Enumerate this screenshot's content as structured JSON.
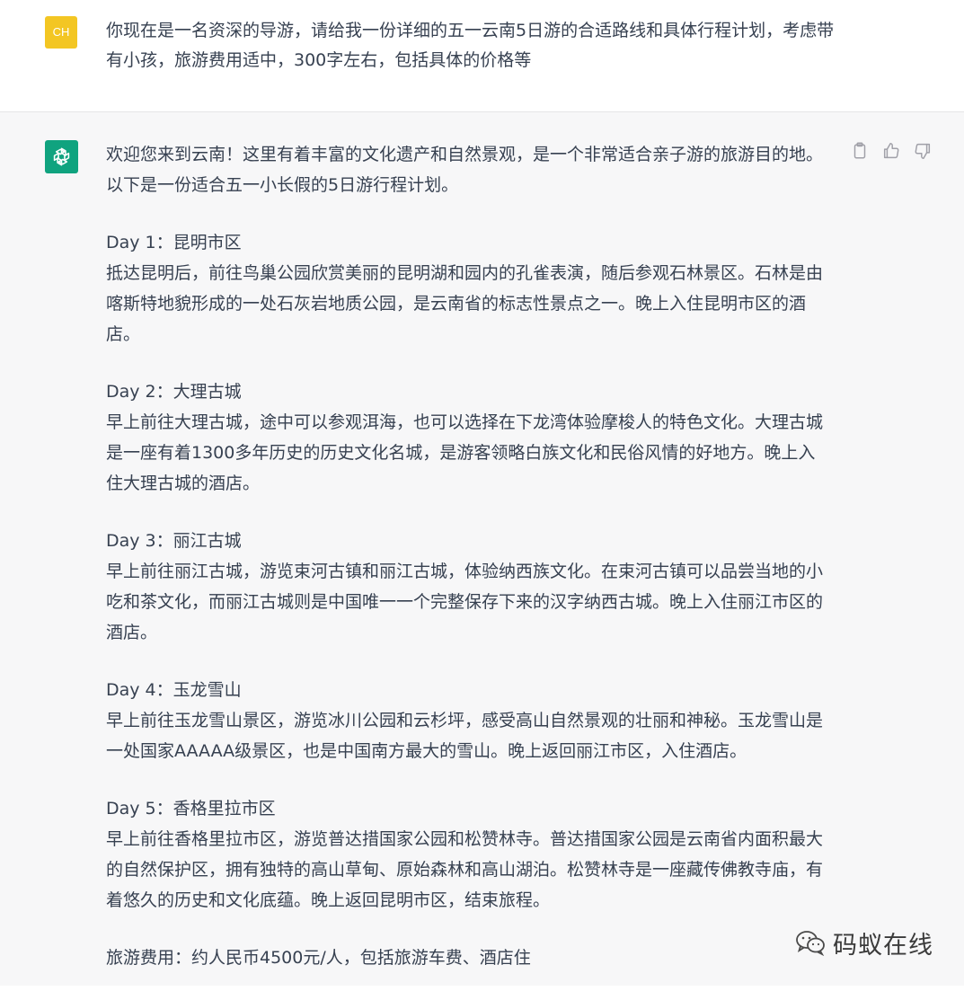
{
  "user": {
    "avatar_initials": "CH",
    "avatar_color": "#f3c623",
    "message": "你现在是一名资深的导游，请给我一份详细的五一云南5日游的合适路线和具体行程计划，考虑带有小孩，旅游费用适中，300字左右，包括具体的价格等"
  },
  "assistant": {
    "avatar_color": "#10a37f",
    "avatar_icon": "openai-logo-icon",
    "intro": "欢迎您来到云南！这里有着丰富的文化遗产和自然景观，是一个非常适合亲子游的旅游目的地。以下是一份适合五一小长假的5日游行程计划。",
    "days": [
      {
        "title": "Day 1：昆明市区",
        "body": "抵达昆明后，前往鸟巢公园欣赏美丽的昆明湖和园内的孔雀表演，随后参观石林景区。石林是由喀斯特地貌形成的一处石灰岩地质公园，是云南省的标志性景点之一。晚上入住昆明市区的酒店。"
      },
      {
        "title": "Day 2：大理古城",
        "body": "早上前往大理古城，途中可以参观洱海，也可以选择在下龙湾体验摩梭人的特色文化。大理古城是一座有着1300多年历史的历史文化名城，是游客领略白族文化和民俗风情的好地方。晚上入住大理古城的酒店。"
      },
      {
        "title": "Day 3：丽江古城",
        "body": "早上前往丽江古城，游览束河古镇和丽江古城，体验纳西族文化。在束河古镇可以品尝当地的小吃和茶文化，而丽江古城则是中国唯一一个完整保存下来的汉字纳西古城。晚上入住丽江市区的酒店。"
      },
      {
        "title": "Day 4：玉龙雪山",
        "body": "早上前往玉龙雪山景区，游览冰川公园和云杉坪，感受高山自然景观的壮丽和神秘。玉龙雪山是一处国家AAAAA级景区，也是中国南方最大的雪山。晚上返回丽江市区，入住酒店。"
      },
      {
        "title": "Day 5：香格里拉市区",
        "body": "早上前往香格里拉市区，游览普达措国家公园和松赞林寺。普达措国家公园是云南省内面积最大的自然保护区，拥有独特的高山草甸、原始森林和高山湖泊。松赞林寺是一座藏传佛教寺庙，有着悠久的历史和文化底蕴。晚上返回昆明市区，结束旅程。"
      }
    ],
    "cost": "旅游费用：约人民币4500元/人，包括旅游车费、酒店住"
  },
  "actions": {
    "icons": [
      "clipboard-icon",
      "thumbs-up-icon",
      "thumbs-down-icon"
    ]
  },
  "watermark": {
    "text": "码蚁在线",
    "icon": "wechat-icon"
  }
}
